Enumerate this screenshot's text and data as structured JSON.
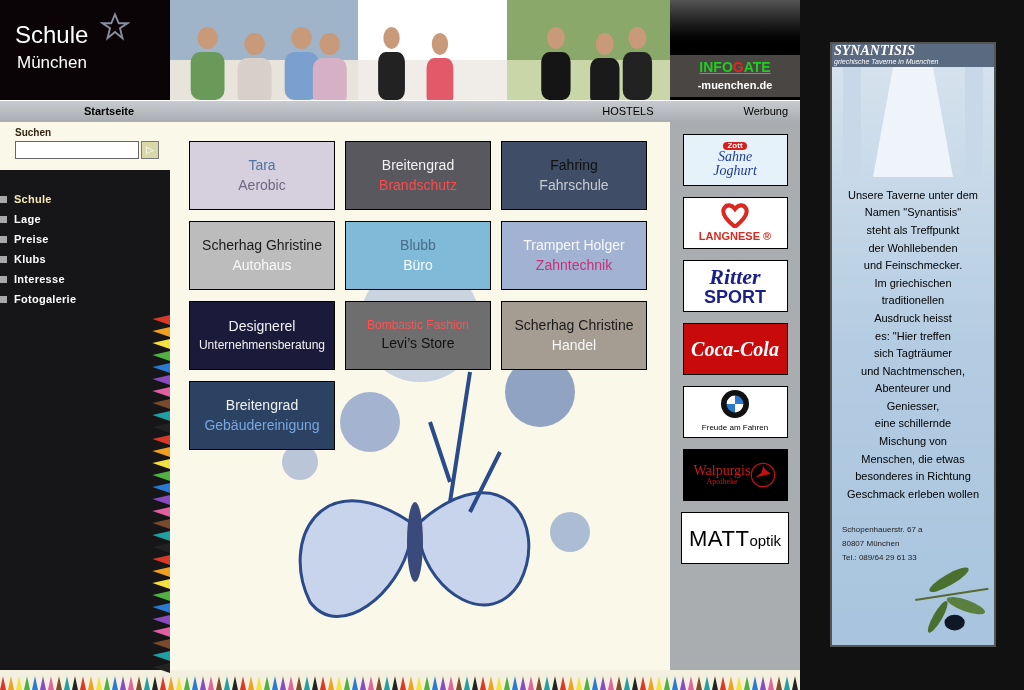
{
  "logo": {
    "title": "Schule",
    "subtitle": "München"
  },
  "infogate": {
    "title_start": "INFO",
    "title_accent": "G",
    "title_end": "ATE",
    "domain": "-muenchen.de"
  },
  "nav": [
    {
      "label": "Startseite",
      "selected": true
    },
    {
      "label": "HOSTELS",
      "selected": false
    },
    {
      "label": "Werbung",
      "selected": false
    }
  ],
  "search": {
    "label": "Suchen",
    "button": "▷"
  },
  "menu": [
    {
      "label": "Schule",
      "selected": true
    },
    {
      "label": "Lage",
      "selected": false
    },
    {
      "label": "Preise",
      "selected": false
    },
    {
      "label": "Klubs",
      "selected": false
    },
    {
      "label": "Interesse",
      "selected": false
    },
    {
      "label": "Fotogalerie",
      "selected": false
    }
  ],
  "tiles": [
    {
      "title": "Tara",
      "subtitle": "Aerobic",
      "color": "#d6d0de"
    },
    {
      "title": "Breitengrad",
      "subtitle": "Brandschutz",
      "color": "#58585e"
    },
    {
      "title": "Fahring",
      "subtitle": "Fahrschule",
      "color": "#3f4e66"
    },
    {
      "title": "Scherhag Ghristine",
      "subtitle": "Autohaus",
      "color": "#bcbcbc"
    },
    {
      "title": "Blubb",
      "subtitle": "Büro",
      "color": "#7fbad8"
    },
    {
      "title": "Trampert Holger",
      "subtitle": "Zahntechnik",
      "color": "#a2b2d2"
    },
    {
      "title": "Designerel",
      "subtitle": "Unternehmensberatung",
      "color": "#1c1a3a"
    },
    {
      "title": "Bombastic Fashion",
      "subtitle": "Levi’s Store",
      "color": "#6e6e6e"
    },
    {
      "title": "Scherhag Christine",
      "subtitle": "Handel",
      "color": "#a59d92"
    },
    {
      "title": "Breitengrad",
      "subtitle": "Gebäudereinigung",
      "color": "#2b4262"
    }
  ],
  "ads": [
    {
      "kind": "zott",
      "lines": [
        "Zott",
        "Sahne",
        "Joghurt"
      ]
    },
    {
      "kind": "langnese",
      "lines": [
        "LANGNESE ®"
      ]
    },
    {
      "kind": "ritter",
      "lines": [
        "Ritter",
        "SPORT"
      ]
    },
    {
      "kind": "cola",
      "lines": [
        "Coca-Cola"
      ]
    },
    {
      "kind": "bmw",
      "lines": [
        "Freude am Fahren"
      ]
    },
    {
      "kind": "walpurgis",
      "lines": [
        "Walpurgis",
        "Apotheke"
      ]
    },
    {
      "kind": "matt",
      "lines": [
        "MATT",
        "optik"
      ]
    }
  ],
  "side_ad": {
    "title": "SYNANTISIS",
    "subtitle": "griechische Taverne in Muenchen",
    "text": [
      "Unsere Taverne unter dem",
      "Namen \"Synantisis\"",
      "steht als Treffpunkt",
      "der Wohllebenden",
      "und Feinschmecker.",
      "Im griechischen",
      "traditionellen",
      "Ausdruck heisst",
      "es: \"Hier treffen",
      "sich Tagträumer",
      "und Nachtmenschen,",
      "Abenteurer und",
      "Geniesser,",
      "eine schillernde",
      "Mischung von",
      "Menschen, die etwas",
      "besonderes in Richtung",
      "Geschmack erleben wollen"
    ],
    "address": [
      "Schopenhauerstr. 67 a",
      "80807 München",
      "Tel.: 089/64 29 61 33"
    ]
  }
}
